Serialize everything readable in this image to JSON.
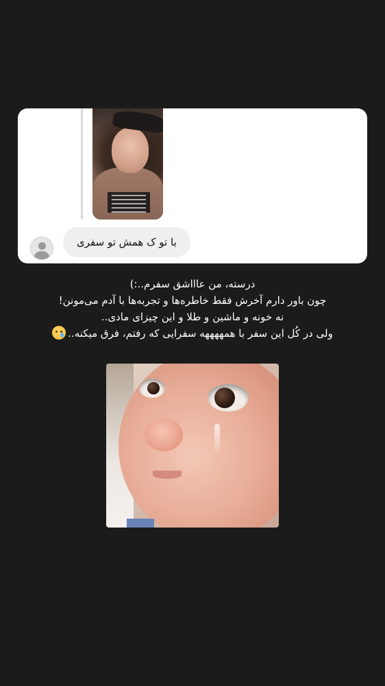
{
  "dm": {
    "reply_text": "با تو ک همش تو سفری"
  },
  "caption": {
    "lines": [
      "درسته، من عاااشق سفرم..:)",
      "چون باور دارم آخرش فقط خاطره‌ها و تجربه‌ها با آدم می‌مونن!",
      "نه خونه و ماشین و طلا و این چیزای مادی..",
      "ولی در کُل این سفر با همههههه سفرایی که رفتم، فرق میکنه.."
    ],
    "emoji": "crying-face"
  },
  "colors": {
    "background": "#1b1b1b",
    "card": "#ffffff",
    "bubble": "#efefef",
    "caption_text": "#ffffff"
  }
}
